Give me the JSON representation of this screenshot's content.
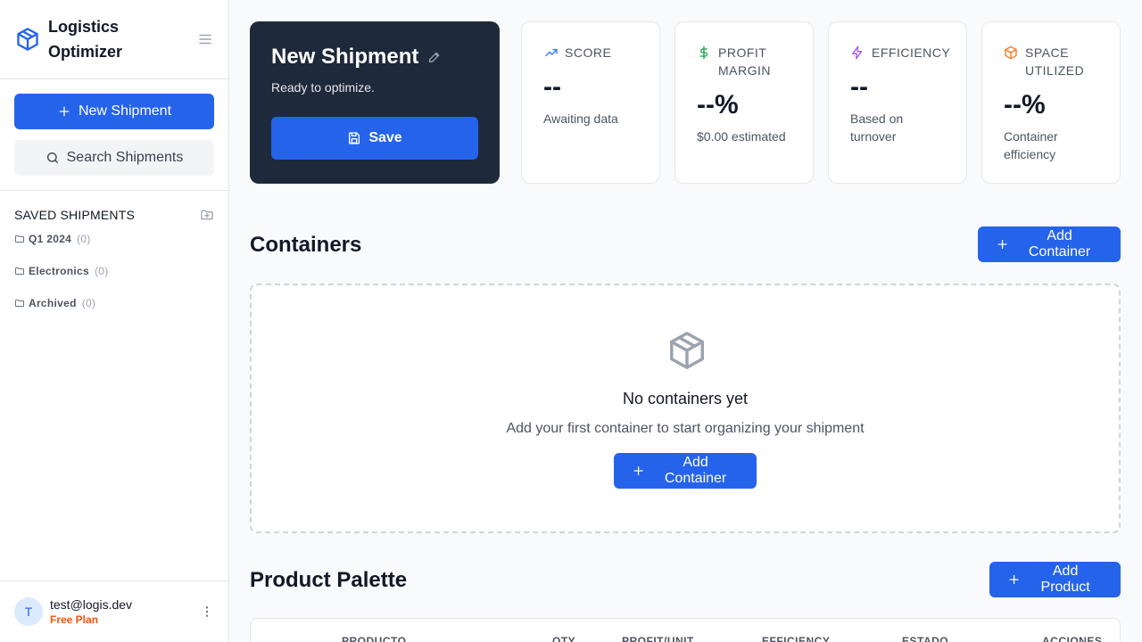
{
  "brand": {
    "title": "Logistics Optimizer"
  },
  "sidebar": {
    "new_shipment_label": "New Shipment",
    "search_label": "Search Shipments",
    "saved_title": "SAVED SHIPMENTS",
    "folders": [
      {
        "name": "Q1 2024",
        "count": "(0)"
      },
      {
        "name": "Electronics",
        "count": "(0)"
      },
      {
        "name": "Archived",
        "count": "(0)"
      }
    ],
    "user": {
      "initial": "T",
      "email": "test@logis.dev",
      "plan": "Free Plan"
    }
  },
  "hero": {
    "title": "New Shipment",
    "subtitle": "Ready to optimize.",
    "save_label": "Save"
  },
  "stats": [
    {
      "label": "SCORE",
      "value": "--",
      "note": "Awaiting data",
      "icon": "trending-up-icon",
      "color": "#3b82f6"
    },
    {
      "label": "PROFIT MARGIN",
      "value": "--%",
      "note": "$0.00 estimated",
      "icon": "dollar-icon",
      "color": "#16a34a"
    },
    {
      "label": "EFFICIENCY",
      "value": "--",
      "note": "Based on turnover",
      "icon": "lightning-icon",
      "color": "#a855f7"
    },
    {
      "label": "SPACE UTILIZED",
      "value": "--%",
      "note": "Container efficiency",
      "icon": "package-icon",
      "color": "#f97316"
    }
  ],
  "containers": {
    "title": "Containers",
    "add_label": "Add Container",
    "empty_title": "No containers yet",
    "empty_subtitle": "Add your first container to start organizing your shipment",
    "empty_add_label": "Add Container"
  },
  "palette": {
    "title": "Product Palette",
    "add_label": "Add Product",
    "columns": [
      "PRODUCTO",
      "QTY",
      "PROFIT/UNIT",
      "EFFICIENCY",
      "ESTADO",
      "ACCIONES"
    ]
  },
  "colors": {
    "accent": "#2563eb",
    "hero_bg": "#1e293b",
    "plan": "#ea580c"
  }
}
